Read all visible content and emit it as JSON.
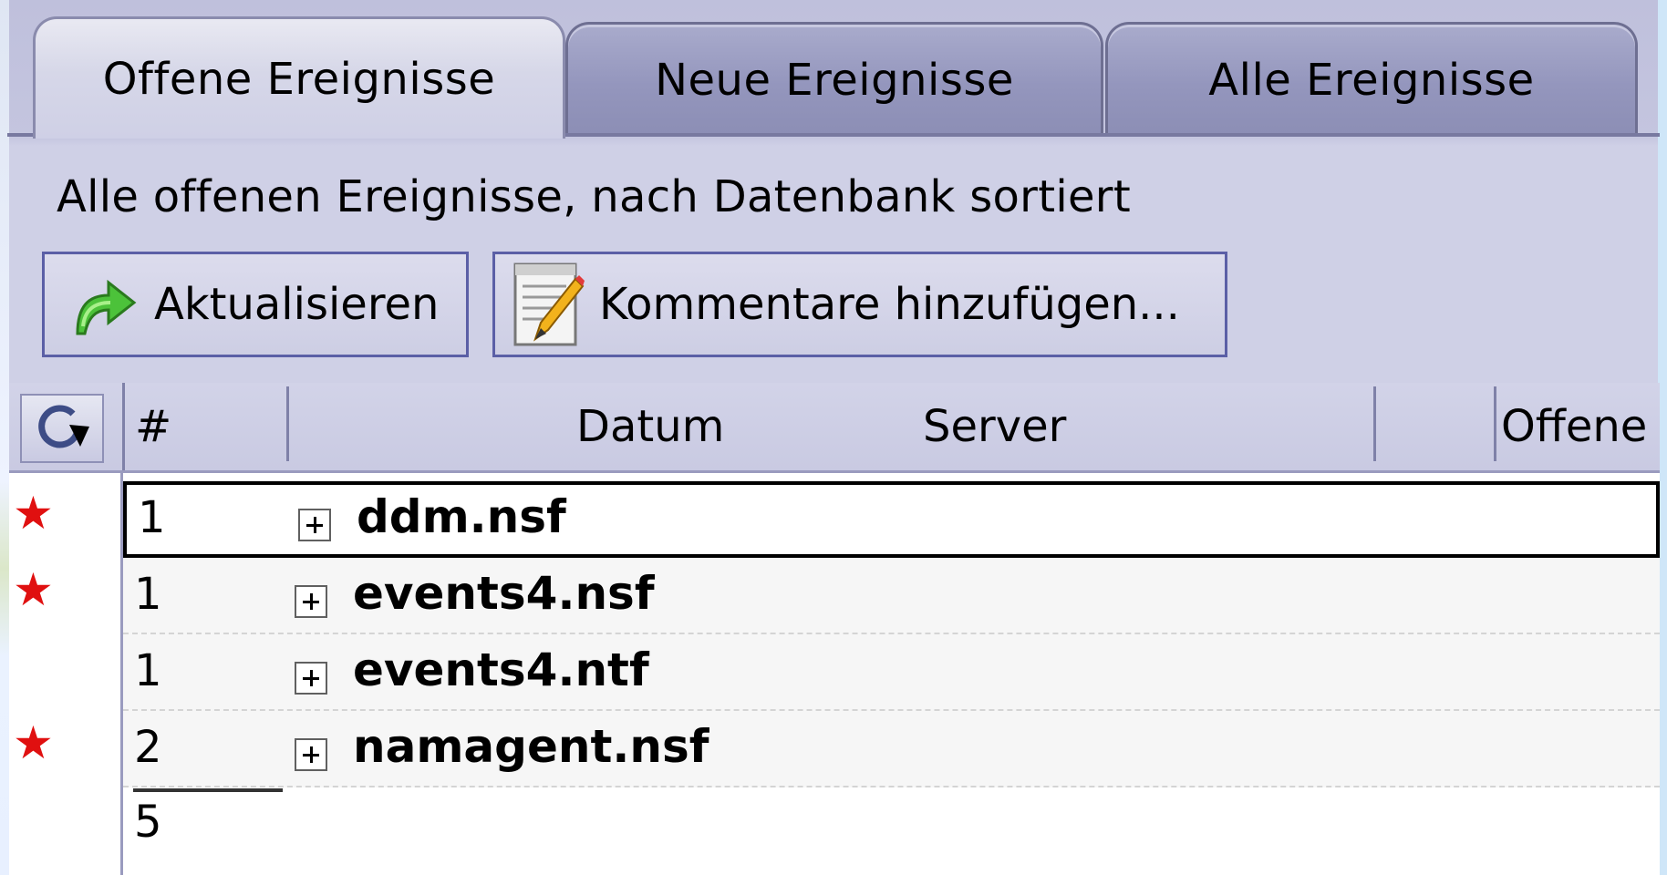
{
  "tabs": [
    {
      "label": "Offene Ereignisse",
      "active": true
    },
    {
      "label": "Neue Ereignisse",
      "active": false
    },
    {
      "label": "Alle Ereignisse",
      "active": false
    }
  ],
  "subtitle": "Alle offenen Ereignisse, nach Datenbank sortiert",
  "toolbar": {
    "refresh_label": "Aktualisieren",
    "refresh_icon": "green-curved-arrow-icon",
    "comment_label": "Kommentare hinzufügen...",
    "comment_icon": "notepad-pencil-icon"
  },
  "columns": {
    "refresh_icon": "refresh-view-icon",
    "count": "#",
    "date": "Datum",
    "server": "Server",
    "open": "Offene E"
  },
  "rows": [
    {
      "starred": true,
      "count": "1",
      "name": "ddm.nsf",
      "selected": true
    },
    {
      "starred": true,
      "count": "1",
      "name": "events4.nsf",
      "selected": false
    },
    {
      "starred": false,
      "count": "1",
      "name": "events4.ntf",
      "selected": false
    },
    {
      "starred": true,
      "count": "2",
      "name": "namagent.nsf",
      "selected": false
    }
  ],
  "total": "5",
  "colors": {
    "star": "#e01010",
    "button_border": "#5b5fa6",
    "tab_border": "#6e6f92"
  }
}
